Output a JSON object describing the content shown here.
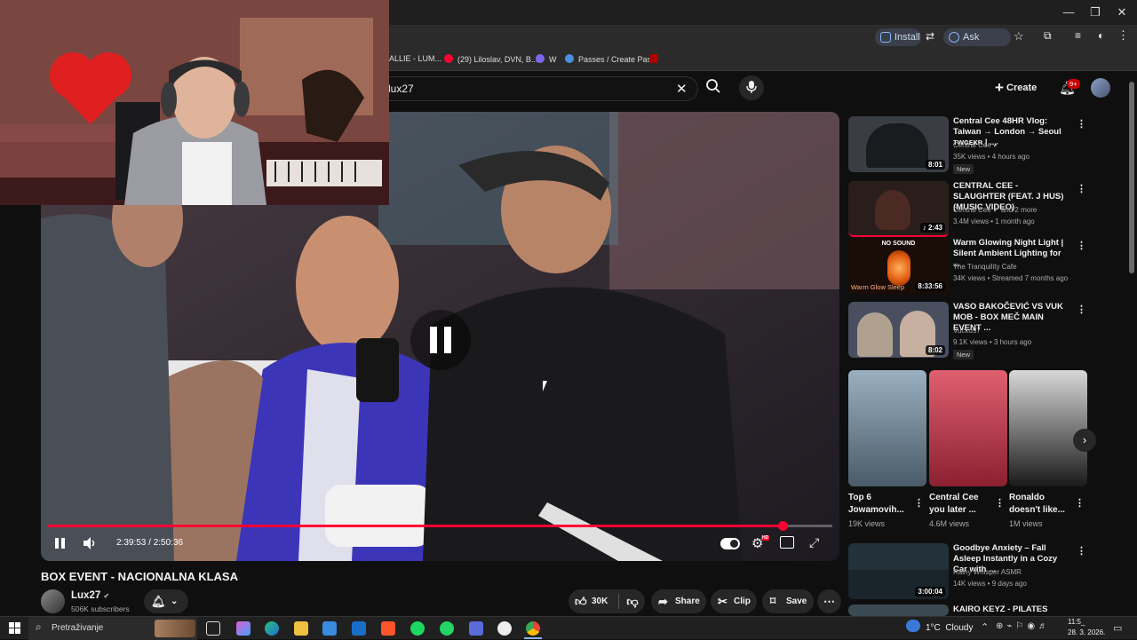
{
  "browser": {
    "install_label": "Install",
    "ask_google_label": "Ask Google",
    "bookmarks": [
      {
        "label": "ALLIE - LUM...",
        "color": "#888888"
      },
      {
        "label": "(29) Liloslav, DVN, B...",
        "color": "#ff0033"
      },
      {
        "label": "W",
        "color": "#7b68ee"
      },
      {
        "label": "Passes / Create Pass",
        "color": "#4a90d9"
      }
    ]
  },
  "youtube": {
    "search_value": "lux27",
    "create_label": "Create",
    "notif_count": "9+"
  },
  "player": {
    "time_display": "2:39:53 / 2:50:36",
    "progress_fraction": 0.937,
    "hd_badge": "HD"
  },
  "video": {
    "title": "BOX EVENT - NACIONALNA KLASA",
    "channel": "Lux27",
    "verified": "✔",
    "subscribers": "506K subscribers",
    "likes": "30K",
    "share_label": "Share",
    "clip_label": "Clip",
    "save_label": "Save"
  },
  "recommendations": [
    {
      "title": "Central Cee 48HR Vlog: Taiwan → London → Seoul ᴛᴡɢᴇᴋʀ | ...",
      "channel": "Central Cee ✔",
      "meta": "35K views • 4 hours ago",
      "badge": "New",
      "duration": "8:01",
      "thumb": "#3a3d44"
    },
    {
      "title": "CENTRAL CEE - SLAUGHTER (FEAT. J HUS) (MUSIC VIDEO)",
      "channel": "Central Cee ✔ and 2 more",
      "meta": "3.4M views • 1 month ago",
      "badge": "",
      "duration": "♪ 2:43",
      "thumb": "#2a1e1c"
    },
    {
      "title": "Warm Glowing Night Light | Silent Ambient Lighting for ...",
      "channel": "The Tranquility Cafe",
      "meta": "34K views • Streamed 7 months ago",
      "badge": "",
      "duration": "8:33:56",
      "thumb": "#1a0c06",
      "overlay_top": "NO SOUND",
      "overlay_bottom": "Warm Glow Sleep"
    },
    {
      "title": "VASO BAKOČEVIĆ VS VUK MOB - BOX MEČ MAIN EVENT ...",
      "channel": "Vucko97",
      "meta": "9.1K views • 3 hours ago",
      "badge": "New",
      "duration": "8:02",
      "thumb": "#4a4f60"
    },
    {
      "title": "Goodbye Anxiety – Fall Asleep Instantly in a Cozy Car with ...",
      "channel": "Rainy Whisper ASMR",
      "meta": "14K views • 9 days ago",
      "badge": "",
      "duration": "3:00:04",
      "thumb": "#23313a"
    },
    {
      "title": "KAIRO KEYZ - PILATES [MUSIC",
      "channel": "",
      "meta": "",
      "badge": "",
      "duration": "",
      "thumb": "#3b4a52"
    }
  ],
  "shorts": [
    {
      "title": "Top 6 Jowamovih...",
      "views": "19K views",
      "thumb": "#6e7a84"
    },
    {
      "title": "Central Cee you later ...",
      "views": "4.6M views",
      "thumb": "#c04a5a"
    },
    {
      "title": "Ronaldo doesn't like...",
      "views": "1M views",
      "thumb": "#c8c8c8"
    }
  ],
  "taskbar": {
    "search_placeholder": "Pretraživanje",
    "weather": "1°C  Cloudy",
    "time": "11:5_",
    "date": "28. 3. 2026."
  },
  "colors": {
    "accent": "#ff0033",
    "bg": "#0f0f0f"
  }
}
